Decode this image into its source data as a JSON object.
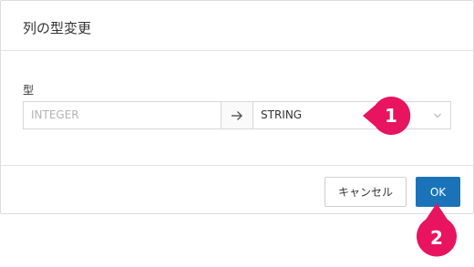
{
  "dialog": {
    "title": "列の型変更"
  },
  "field": {
    "label": "型",
    "from_type": "INTEGER",
    "to_type": "STRING"
  },
  "footer": {
    "cancel_label": "キャンセル",
    "ok_label": "OK"
  },
  "callouts": [
    {
      "number": "1"
    },
    {
      "number": "2"
    }
  ],
  "colors": {
    "primary_button": "#1a73b8",
    "callout": "#e8145f"
  },
  "icons": {
    "arrow": "arrow-right-icon",
    "select": "chevron-down-icon"
  }
}
